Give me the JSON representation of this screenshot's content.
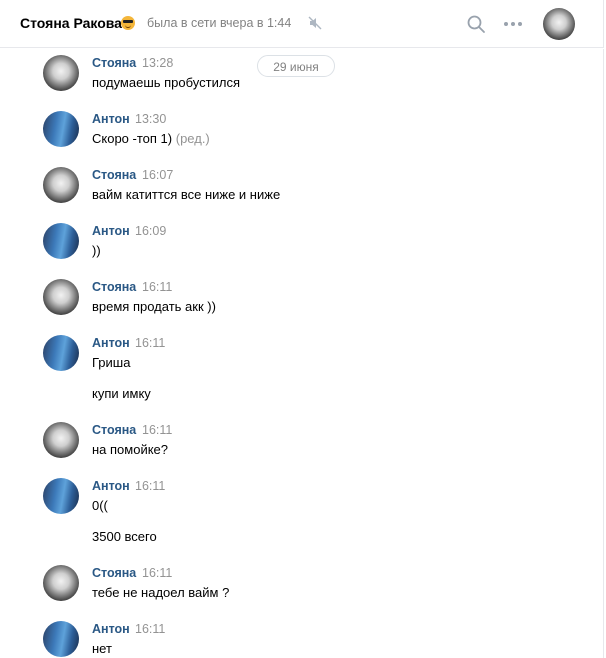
{
  "header": {
    "contact_name": "Стояна Ракова",
    "status": "была в сети вчера в 1:44",
    "icons": {
      "emoji": "sunglasses-emoji-icon",
      "mute": "muted-speaker-icon",
      "search": "search-icon",
      "more": "more-dots-icon",
      "avatar": "avatar"
    }
  },
  "date_divider": "29 июня",
  "messages": [
    {
      "author": "Стояна",
      "time": "13:28",
      "lines": [
        "подумаешь пробустился"
      ]
    },
    {
      "author": "Антон",
      "time": "13:30",
      "lines": [
        "Скоро -топ 1)"
      ],
      "edited": "(ред.)"
    },
    {
      "author": "Стояна",
      "time": "16:07",
      "lines": [
        "вайм катиттся все ниже и ниже"
      ]
    },
    {
      "author": "Антон",
      "time": "16:09",
      "lines": [
        "))"
      ]
    },
    {
      "author": "Стояна",
      "time": "16:11",
      "lines": [
        "время продать акк ))"
      ]
    },
    {
      "author": "Антон",
      "time": "16:11",
      "lines": [
        "Гриша",
        "купи имку"
      ]
    },
    {
      "author": "Стояна",
      "time": "16:11",
      "lines": [
        "на помойке?"
      ]
    },
    {
      "author": "Антон",
      "time": "16:11",
      "lines": [
        "0((",
        "3500 всего"
      ]
    },
    {
      "author": "Стояна",
      "time": "16:11",
      "lines": [
        "тебе не надоел вайм ?"
      ]
    },
    {
      "author": "Антон",
      "time": "16:11",
      "lines": [
        "нет"
      ]
    }
  ],
  "colors": {
    "author_link": "#2a5885",
    "muted_text": "#828282",
    "divider": "#e7e8ec"
  }
}
